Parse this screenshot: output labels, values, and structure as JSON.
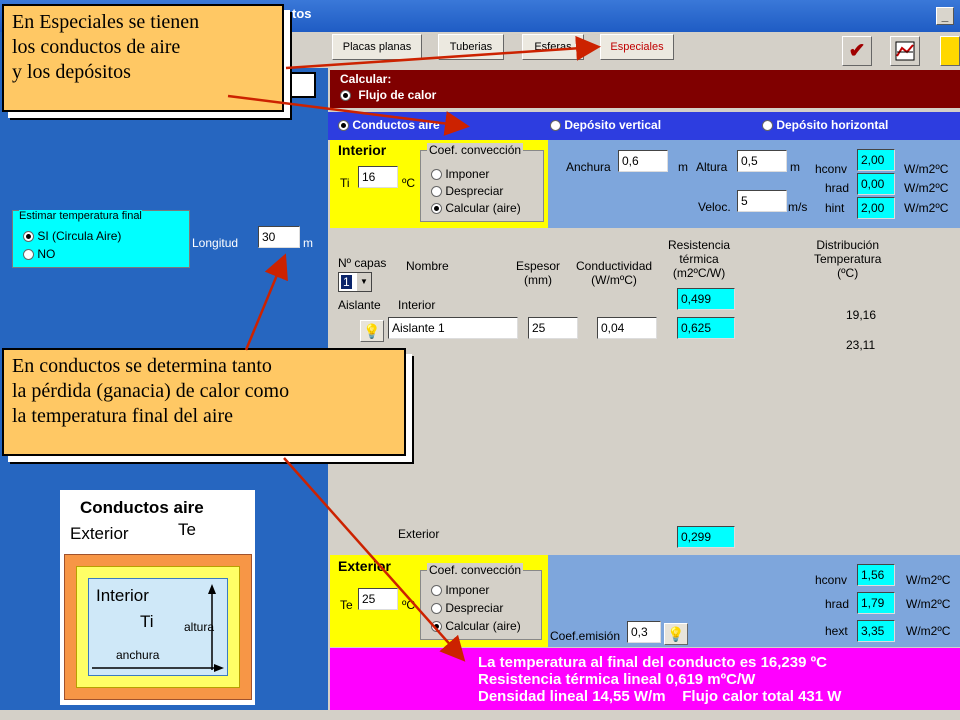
{
  "window": {
    "title_fragment": "tos",
    "min_label": "_",
    "restore_label": "□"
  },
  "toolbar": {
    "buttons": [
      "Placas planas",
      "Tuberias",
      "Esferas",
      "Especiales"
    ],
    "ok_icon": "✔",
    "chart_icon": "chart-icon",
    "book_icon": "book-icon"
  },
  "calcular": {
    "label": "Calcular:",
    "option": "Flujo de calor"
  },
  "options": {
    "a": "Conductos aire",
    "b": "Depósito vertical",
    "c": "Depósito horizontal"
  },
  "interior": {
    "title": "Interior",
    "ti_label": "Ti",
    "ti_value": "16",
    "ti_unit": "ºC",
    "conv_title": "Coef. convección",
    "conv_opts": [
      "Imponer",
      "Despreciar",
      "Calcular (aire)"
    ],
    "anchura_label": "Anchura",
    "anchura_value": "0,6",
    "anchura_unit": "m",
    "altura_label": "Altura",
    "altura_value": "0,5",
    "altura_unit": "m",
    "veloc_label": "Veloc.",
    "veloc_value": "5",
    "veloc_unit": "m/s",
    "hconv_label": "hconv",
    "hconv_value": "2,00",
    "hrad_label": "hrad",
    "hrad_value": "0,00",
    "hint_label": "hint",
    "hint_value": "2,00",
    "unit": "W/m2ºC"
  },
  "estimar": {
    "title": "Estimar temperatura final",
    "si": "SI  (Circula Aire)",
    "no": "NO"
  },
  "longitud": {
    "label": "Longitud",
    "value": "30",
    "unit": "m"
  },
  "capas": {
    "nc_label": "Nº capas",
    "nc_value": "1",
    "h_nombre": "Nombre",
    "h_espesor": "Espesor\n(mm)",
    "h_cond": "Conductividad\n(W/mºC)",
    "h_res": "Resistencia\ntérmica\n(m2ºC/W)",
    "h_dist": "Distribución\nTemperatura\n(ºC)",
    "aislante_label": "Aislante",
    "interior_label": "Interior",
    "res_int": "0,499",
    "layer_name": "Aislante 1",
    "layer_esp": "25",
    "layer_cond": "0,04",
    "layer_res": "0,625",
    "temp1": "19,16",
    "temp2": "23,11",
    "exterior_label": "Exterior",
    "res_ext": "0,299"
  },
  "exterior": {
    "title": "Exterior",
    "te_label": "Te",
    "te_value": "25",
    "te_unit": "ºC",
    "conv_title": "Coef. convección",
    "conv_opts": [
      "Imponer",
      "Despreciar",
      "Calcular (aire)"
    ],
    "emis_label": "Coef.emisión",
    "emis_value": "0,3",
    "hconv_label": "hconv",
    "hconv_value": "1,56",
    "hrad_label": "hrad",
    "hrad_value": "1,79",
    "hext_label": "hext",
    "hext_value": "3,35",
    "unit": "W/m2ºC"
  },
  "results": {
    "line1": "La temperatura al final del conducto es 16,239 ºC",
    "line2": "Resistencia térmica lineal 0,619 mºC/W",
    "line3": "Densidad lineal 14,55 W/m    Flujo calor total 431 W"
  },
  "callouts": {
    "c1": "En Especiales se tienen\nlos conductos de aire\ny los depósitos",
    "c2": "En conductos se determina tanto\nla pérdida (ganacia) de calor como\nla temperatura final del aire"
  },
  "diagram": {
    "title": "Conductos aire",
    "exterior": "Exterior",
    "te": "Te",
    "interior": "Interior",
    "ti": "Ti",
    "altura": "altura",
    "anchura": "anchura"
  },
  "colors": {
    "calc_bar": "#800000",
    "options_bar": "#2d3de0",
    "results_bar": "#ff00ff",
    "callout": "#ffc864"
  }
}
